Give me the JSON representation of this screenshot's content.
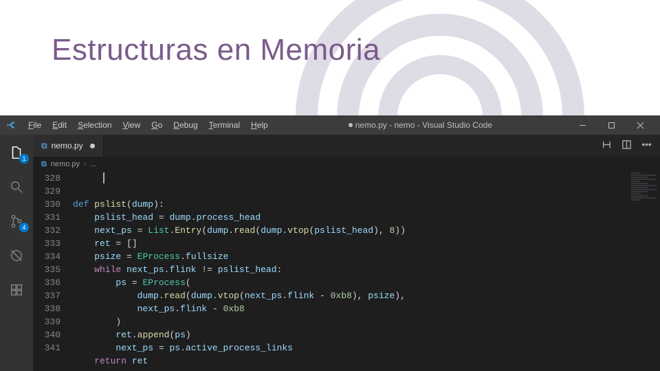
{
  "slide": {
    "title": "Estructuras en Memoria"
  },
  "titlebar": {
    "menu": [
      "File",
      "Edit",
      "Selection",
      "View",
      "Go",
      "Debug",
      "Terminal",
      "Help"
    ],
    "center_state": "● ",
    "center_text": "nemo.py - nemo - Visual Studio Code"
  },
  "activitybar": {
    "explorer_badge": "1",
    "scm_badge": "4"
  },
  "tabs": {
    "tab1": {
      "label": "nemo.py"
    }
  },
  "breadcrumb": {
    "file": "nemo.py",
    "segment": "..."
  },
  "gutter": {
    "l0": "328",
    "l1": "329",
    "l2": "330",
    "l3": "331",
    "l4": "332",
    "l5": "333",
    "l6": "334",
    "l7": "335",
    "l8": "336",
    "l9": "337",
    "l10": "338",
    "l11": "339",
    "l12": "340",
    "l13": "341"
  },
  "code": {
    "def": "def",
    "fn_pslist": "pslist",
    "param_dump": "dump",
    "pslist_head": "pslist_head",
    "process_head": "process_head",
    "next_ps": "next_ps",
    "List": "List",
    "Entry": "Entry",
    "read": "read",
    "vtop": "vtop",
    "eight": "8",
    "ret": "ret",
    "psize": "psize",
    "EProcess": "EProcess",
    "fullsize": "fullsize",
    "while_kw": "while",
    "flink": "flink",
    "ps": "ps",
    "hex_b8": "0xb8",
    "append": "append",
    "apl": "active_process_links",
    "return_kw": "return"
  }
}
